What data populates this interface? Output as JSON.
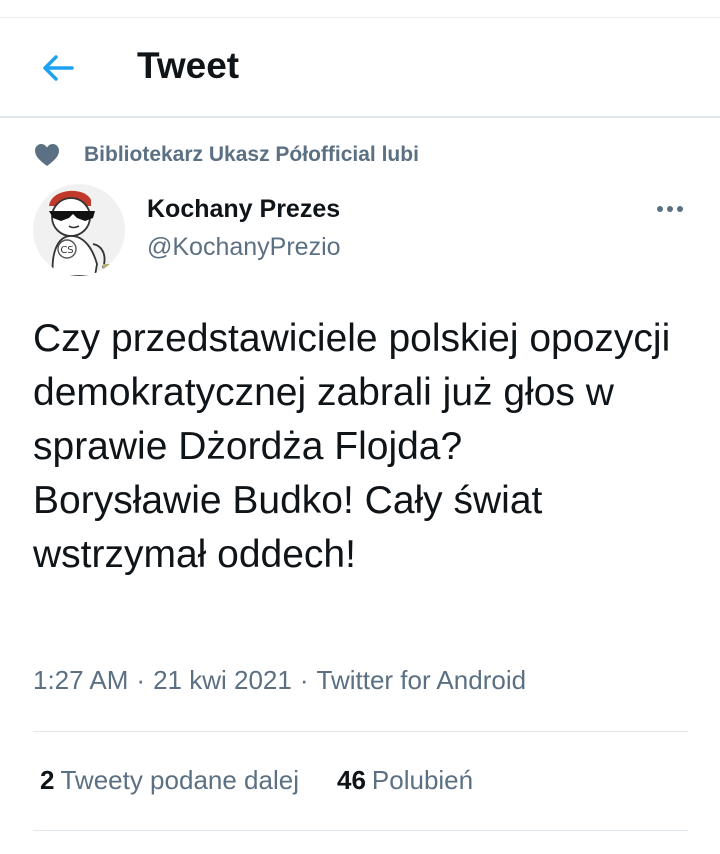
{
  "colors": {
    "accent": "#1da1f2",
    "text_primary": "#0f1419",
    "text_secondary": "#5b7083",
    "divider": "#e1e8ed"
  },
  "header": {
    "back_icon": "arrow-left-icon",
    "title": "Tweet"
  },
  "social_context": {
    "icon": "heart-icon",
    "text": "Bibliotekarz Ukasz Półofficial lubi"
  },
  "tweet": {
    "author": {
      "name": "Kochany Prezes",
      "handle": "@KochanyPrezio",
      "avatar_text": "CS"
    },
    "more_icon": "more-dots-icon",
    "text": "Czy przedstawiciele polskiej opozycji demokratycznej zabrali już głos w sprawie Dżordża Flojda?\nBorysławie Budko! Cały świat wstrzymał oddech!",
    "meta": {
      "time": "1:27 AM",
      "separator": "·",
      "date": "21 kwi 2021",
      "source": "Twitter for Android"
    },
    "stats": {
      "retweets_count": "2",
      "retweets_label": "Tweety podane dalej",
      "likes_count": "46",
      "likes_label": "Polubień"
    }
  }
}
